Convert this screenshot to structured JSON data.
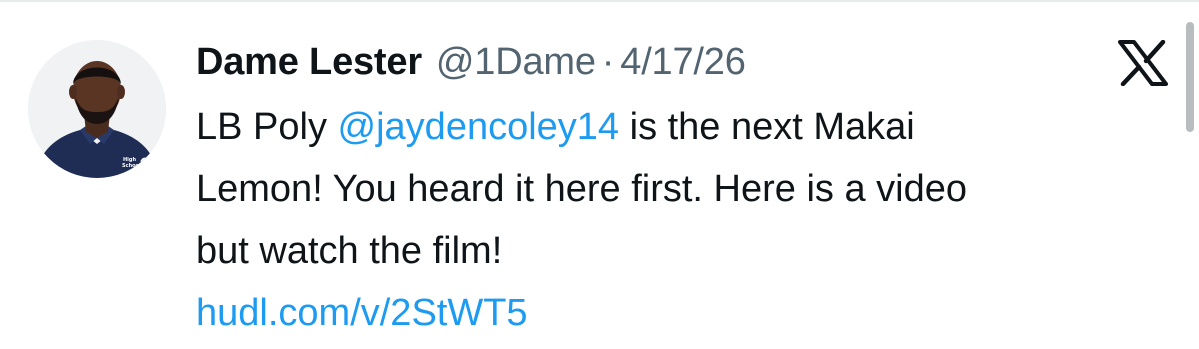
{
  "tweet": {
    "author": {
      "display_name": "Dame Lester",
      "handle": "@1Dame",
      "avatar_icon": "profile-photo",
      "shirt_text_line1": "High",
      "shirt_text_line2": "School"
    },
    "separator": "·",
    "date": "4/17/26",
    "body": {
      "line1_prefix": "LB Poly ",
      "mention": "@jaydencoley14",
      "line1_suffix": " is the next Makai",
      "line2": "Lemon! You heard it here first. Here is a video",
      "line3": "but watch the film!"
    },
    "link": "hudl.com/v/2StWT5",
    "platform_icon": "x-logo-icon"
  },
  "colors": {
    "text_primary": "#0f1419",
    "text_secondary": "#536471",
    "link_blue": "#1d9bf0",
    "divider": "#e9eaeb",
    "scrollbar": "#b9bcbf"
  }
}
